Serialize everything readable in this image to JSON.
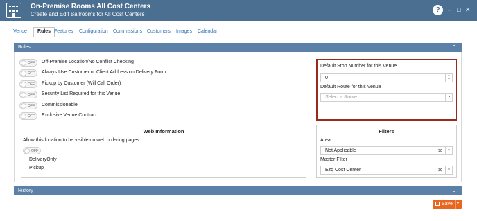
{
  "window": {
    "title": "On-Premise Rooms All Cost Centers",
    "subtitle": "Create and Edit Ballrooms for All Cost Centers",
    "help_label": "?",
    "minimize_label": "–",
    "maximize_label": "□",
    "close_label": "✕"
  },
  "tabs": [
    "Venue",
    "Rules",
    "Features",
    "Configuration",
    "Commissions",
    "Customers",
    "Images",
    "Calendar"
  ],
  "active_tab": "Rules",
  "rules_section": {
    "header": "Rules",
    "toggle_off_label": "OFF",
    "items": [
      {
        "label": "Off-Premise Location/No Conflict Checking",
        "state": "off"
      },
      {
        "label": "Always Use Customer or Client Address on Delivery Form",
        "state": "off"
      },
      {
        "label": "Pickup by Customer (Will Call Order)",
        "state": "off"
      },
      {
        "label": "Security List Required for this Venue",
        "state": "off"
      },
      {
        "label": "Commissionable",
        "state": "off"
      },
      {
        "label": "Exclusive Venue Contract",
        "state": "off"
      }
    ]
  },
  "defaults_panel": {
    "stop_number_label": "Default Stop Number for this Venue",
    "stop_number_value": "0",
    "route_label": "Default Route for this Venue",
    "route_placeholder": "Select a Route"
  },
  "web_info": {
    "title": "Web Information",
    "allow_label": "Allow this location to be visible on web ordering pages",
    "toggle_label": "OFF",
    "options": [
      "DeliveryOnly",
      "Pickup"
    ]
  },
  "filters": {
    "title": "Filters",
    "area_label": "Area",
    "area_value": "Not Applicable",
    "master_filter_label": "Master Filter",
    "master_filter_value": "Ezq Cost Center",
    "clear_icon": "✕",
    "dropdown_icon": "▾"
  },
  "history_section": {
    "header": "History"
  },
  "actions": {
    "save_label": "Save",
    "accent_color": "#e8661d"
  },
  "colors": {
    "titlebar": "#4a6f91",
    "section_header": "#5b81a8",
    "highlight_border": "#9c2a1a"
  }
}
